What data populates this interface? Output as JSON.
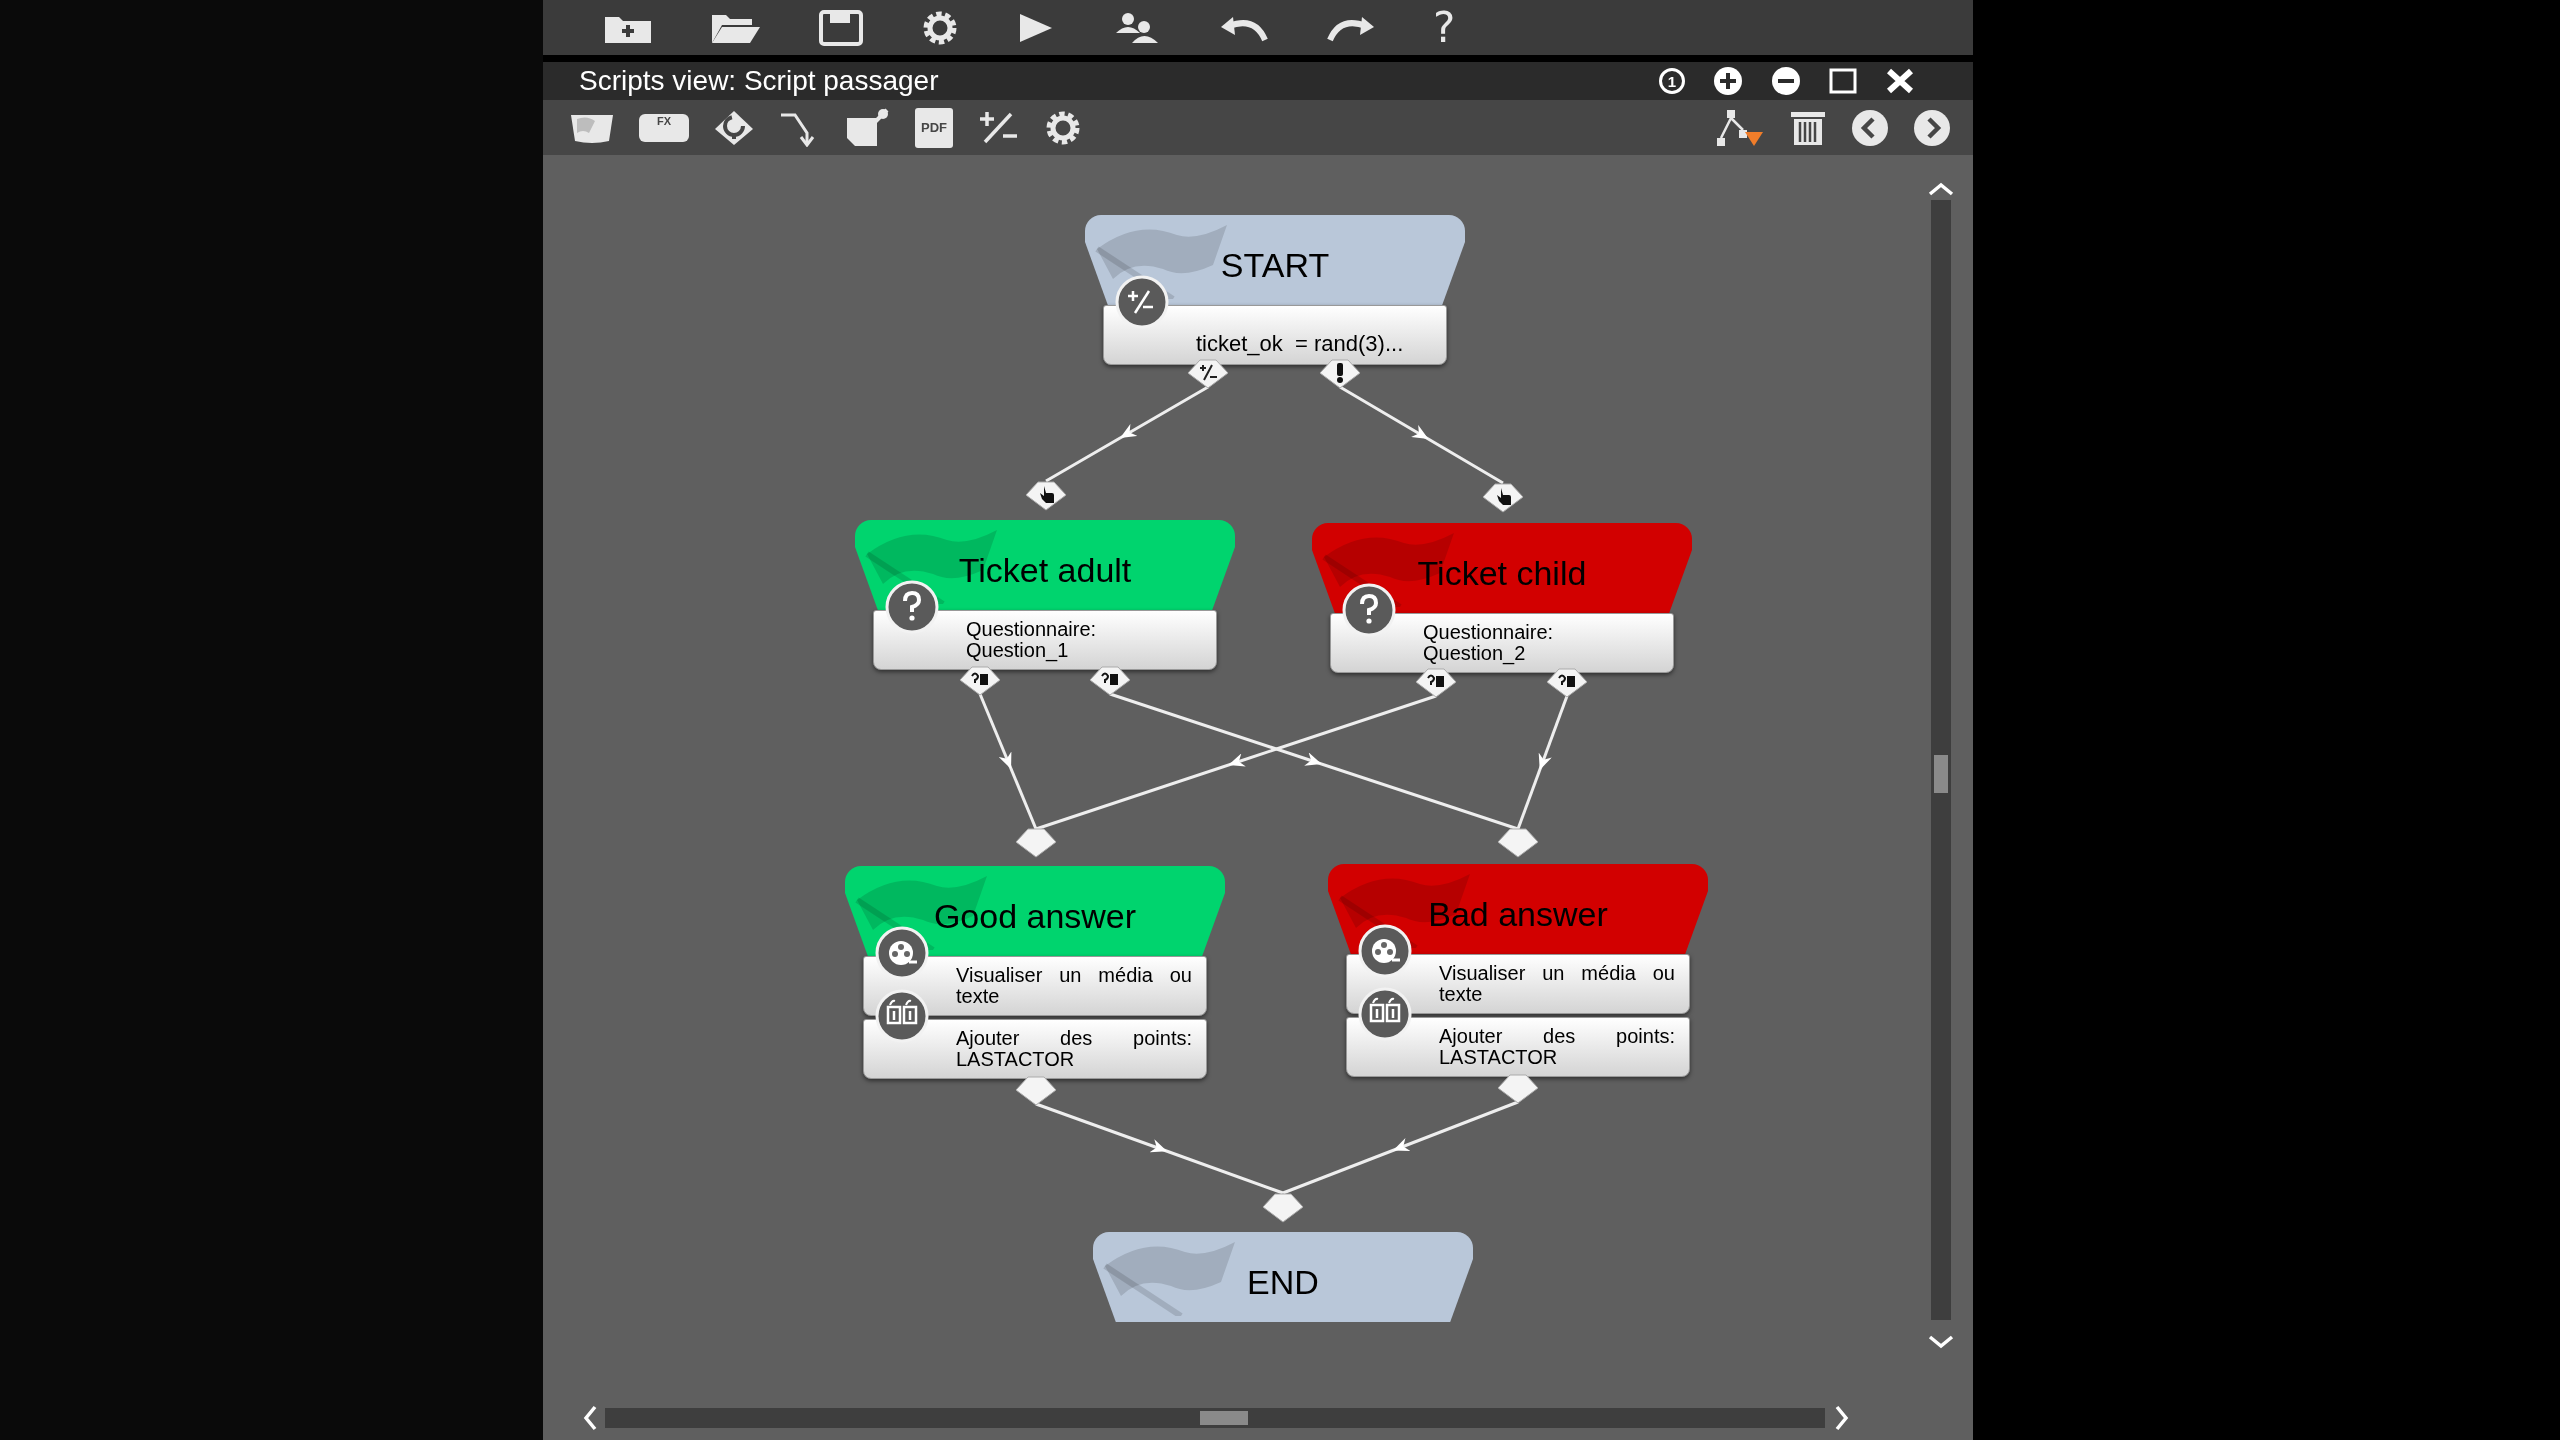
{
  "window": {
    "title": "Scripts view: Script passager"
  },
  "main_toolbar": [
    {
      "kind": "new-folder"
    },
    {
      "kind": "open-folder"
    },
    {
      "kind": "save"
    },
    {
      "kind": "settings"
    },
    {
      "kind": "play"
    },
    {
      "kind": "users"
    },
    {
      "kind": "undo"
    },
    {
      "kind": "redo"
    },
    {
      "kind": "help",
      "label": "?"
    }
  ],
  "window_controls": [
    {
      "kind": "badge",
      "label": "1"
    },
    {
      "kind": "zoom-in"
    },
    {
      "kind": "zoom-out"
    },
    {
      "kind": "maximize"
    },
    {
      "kind": "close"
    }
  ],
  "view_toolbar": [
    {
      "kind": "flag-card"
    },
    {
      "kind": "fx",
      "label": "FX"
    },
    {
      "kind": "question"
    },
    {
      "kind": "connector"
    },
    {
      "kind": "note"
    },
    {
      "kind": "pdf",
      "label": "PDF"
    },
    {
      "kind": "plus-minus"
    },
    {
      "kind": "settings"
    }
  ],
  "view_toolbar_right": [
    {
      "kind": "tree"
    },
    {
      "kind": "trash"
    },
    {
      "kind": "previous"
    },
    {
      "kind": "next"
    }
  ],
  "nodes": [
    {
      "title": "START",
      "color": "#b9c7d9",
      "actions": [
        {
          "kind": "formula",
          "text": "ticket_ok  = rand(3)..."
        }
      ]
    },
    {
      "title": "Ticket adult",
      "color": "#00d46e",
      "actions": [
        {
          "kind": "question",
          "text": "Questionnaire: Question_1"
        }
      ]
    },
    {
      "title": "Ticket child",
      "color": "#d20000",
      "actions": [
        {
          "kind": "question",
          "text": "Questionnaire: Question_2"
        }
      ]
    },
    {
      "title": "Good answer",
      "color": "#00d46e",
      "actions": [
        {
          "kind": "media",
          "text": "Visualiser un média ou texte"
        },
        {
          "kind": "points",
          "text": "Ajouter des points: LASTACTOR"
        }
      ]
    },
    {
      "title": "Bad answer",
      "color": "#d20000",
      "actions": [
        {
          "kind": "media",
          "text": "Visualiser un média ou texte"
        },
        {
          "kind": "points",
          "text": "Ajouter des points: LASTACTOR"
        }
      ]
    },
    {
      "title": "END",
      "color": "#b9c7d9"
    }
  ]
}
